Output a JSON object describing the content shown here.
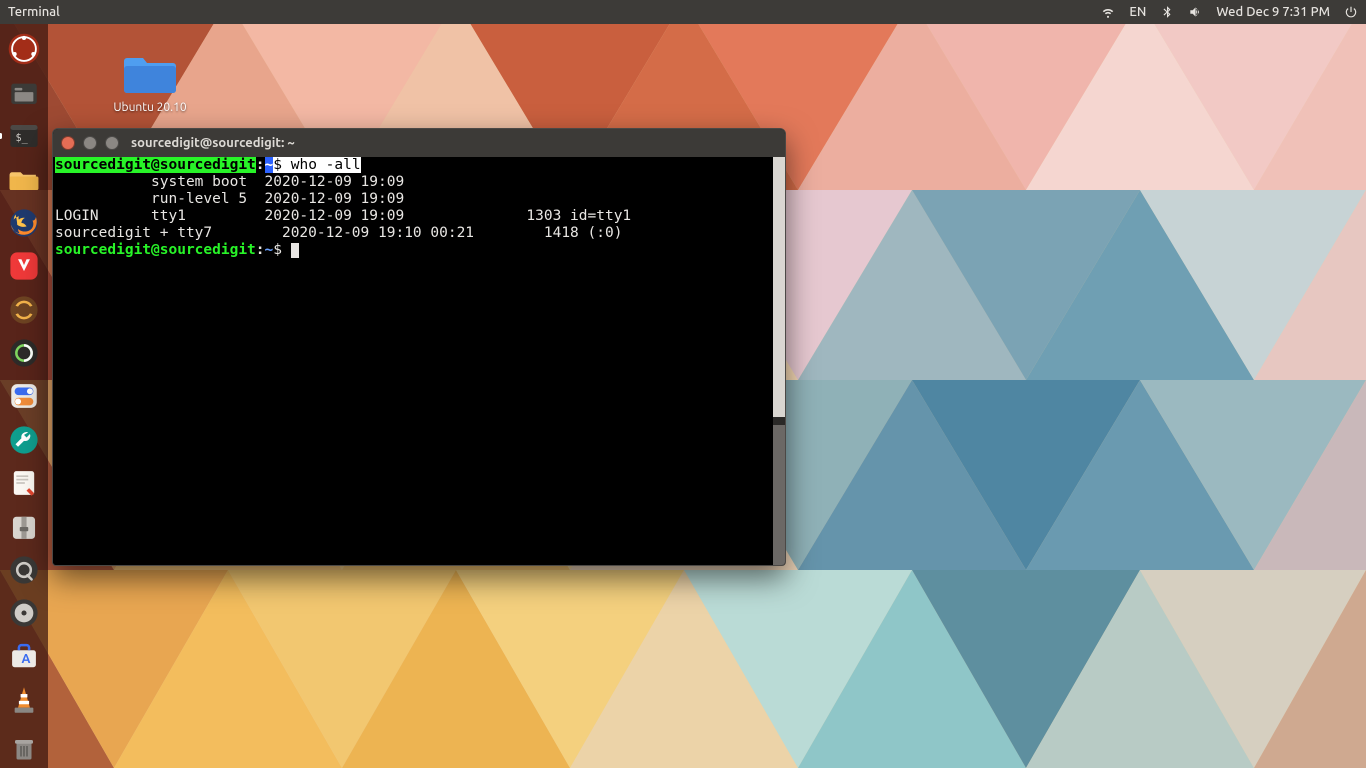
{
  "topbar": {
    "app": "Terminal",
    "lang": "EN",
    "clock": "Wed Dec  9  7:31 PM"
  },
  "desktop": {
    "folder_label": "Ubuntu 20.10"
  },
  "terminal": {
    "window_title": "sourcedigit@sourcedigit: ~",
    "prompt_user": "sourcedigit@sourcedigit",
    "prompt_sep": ":",
    "prompt_cwd": "~",
    "prompt_sym": "$",
    "command": "who -all",
    "output": [
      "           system boot  2020-12-09 19:09",
      "           run-level 5  2020-12-09 19:09",
      "LOGIN      tty1         2020-12-09 19:09              1303 id=tty1",
      "sourcedigit + tty7        2020-12-09 19:10 00:21        1418 (:0)"
    ]
  }
}
